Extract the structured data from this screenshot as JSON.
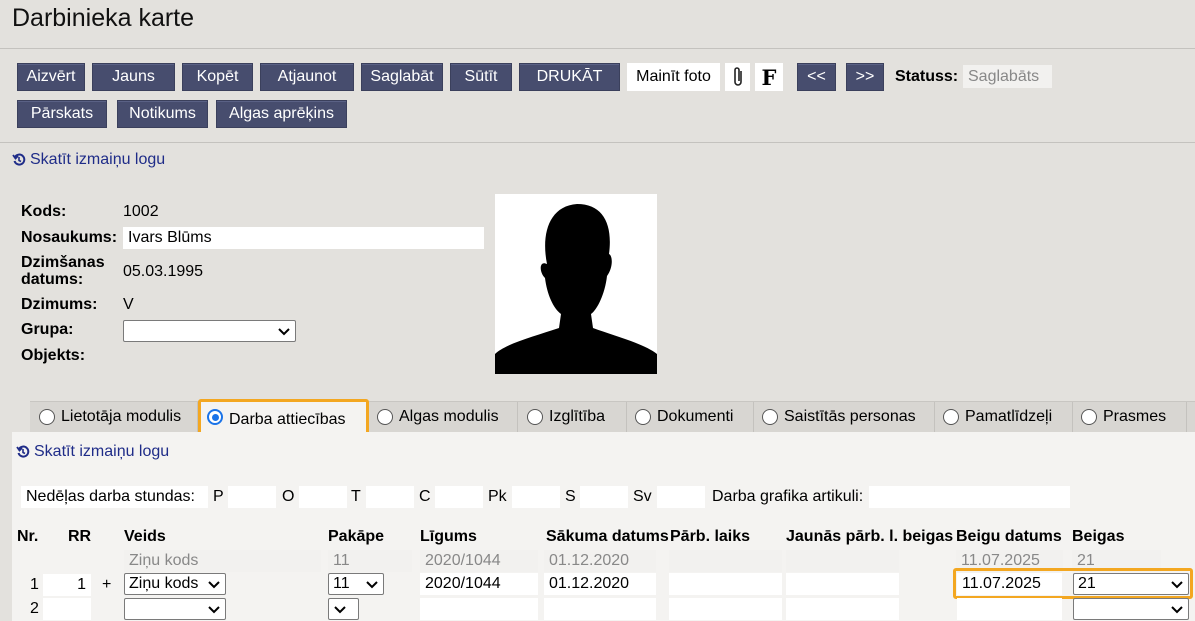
{
  "page": {
    "title": "Darbinieka karte"
  },
  "toolbar": {
    "aizvert": "Aizvērt",
    "jauns": "Jauns",
    "kopet": "Kopēt",
    "atjaunot": "Atjaunot",
    "saglabat": "Saglabāt",
    "sutit": "Sūtīt",
    "drukat": "DRUKĀT",
    "mainit_foto": "Mainīt foto",
    "f_label": "F",
    "prev": "<<",
    "next": ">>",
    "status_label": "Statuss:",
    "status_value": "Saglabāts",
    "parskats": "Pārskats",
    "notikums": "Notikums",
    "algas_aprekins": "Algas aprēķins"
  },
  "history_link": "Skatīt izmaiņu logu",
  "employee": {
    "kods_label": "Kods:",
    "kods": "1002",
    "nosaukums_label": "Nosaukums:",
    "nosaukums": "Ivars Blūms",
    "dzimsanas_label_1": "Dzimšanas",
    "dzimsanas_label_2": "datums:",
    "dzimsanas": "05.03.1995",
    "dzimums_label": "Dzimums:",
    "dzimums": "V",
    "grupa_label": "Grupa:",
    "grupa": "",
    "objekts_label": "Objekts:"
  },
  "tabs": [
    {
      "label": "Lietotāja modulis",
      "selected": false
    },
    {
      "label": "Darba attiecības",
      "selected": true
    },
    {
      "label": "Algas modulis",
      "selected": false
    },
    {
      "label": "Izglītība",
      "selected": false
    },
    {
      "label": "Dokumenti",
      "selected": false
    },
    {
      "label": "Saistītās personas",
      "selected": false
    },
    {
      "label": "Pamatlīdzeļi",
      "selected": false
    },
    {
      "label": "Prasmes",
      "selected": false
    }
  ],
  "hours": {
    "label": "Nedēļas darba stundas:",
    "days": [
      "P",
      "O",
      "T",
      "C",
      "Pk",
      "S",
      "Sv"
    ],
    "grafika_label": "Darba grafika artikuli:"
  },
  "table": {
    "headers": {
      "nr": "Nr.",
      "rr": "RR",
      "veids": "Veids",
      "pakape": "Pakāpe",
      "ligums": "Līgums",
      "sakuma": "Sākuma datums",
      "parb": "Pārb. laiks",
      "jaunas": "Jaunās pārb. l. beigas",
      "beigu": "Beigu datums",
      "beigas": "Beigas"
    },
    "ghost": {
      "veids": "Ziņu kods",
      "pakape": "11",
      "ligums": "2020/1044",
      "sakuma": "01.12.2020",
      "beigu": "11.07.2025",
      "beigas": "21"
    },
    "row1": {
      "nr": "1",
      "rr": "1",
      "plus": "+",
      "veids": "Ziņu kods",
      "pakape": "11",
      "ligums": "2020/1044",
      "sakuma": "01.12.2020",
      "beigu": "11.07.2025",
      "beigas": "21"
    },
    "row2": {
      "nr": "2"
    }
  }
}
